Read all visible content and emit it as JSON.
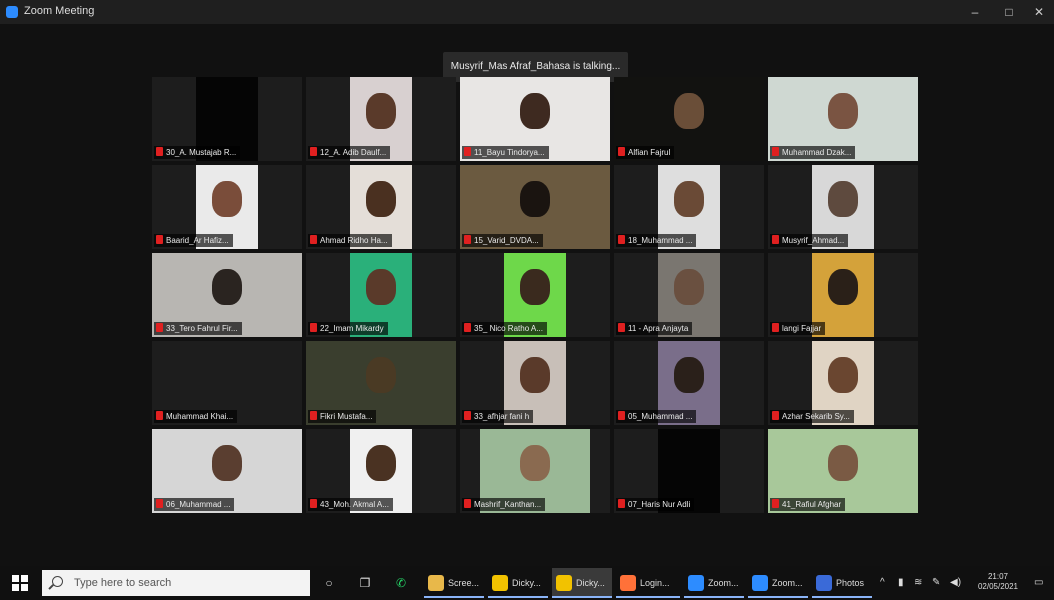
{
  "window": {
    "title": "Zoom Meeting",
    "controls": [
      "–",
      "□",
      "✕"
    ]
  },
  "speaking_banner": "Musyrif_Mas Afraf_Bahasa is talking...",
  "colors": {
    "muted_mic": "#e02020",
    "zoom_blue": "#2d8cff"
  },
  "participants": [
    {
      "name": "30_A. Mustajab R..."
    },
    {
      "name": "12_A. Adib Daulf..."
    },
    {
      "name": "11_Bayu Tindorya..."
    },
    {
      "name": "Alfian Fajrul"
    },
    {
      "name": "Muhammad Dzak..."
    },
    {
      "name": "Baarid_Ar Hafiz..."
    },
    {
      "name": "Ahmad Ridho Ha..."
    },
    {
      "name": "15_Varid_DVDA..."
    },
    {
      "name": "18_Muhammad ..."
    },
    {
      "name": "Musyrif_Ahmad..."
    },
    {
      "name": "33_Tero Fahrul Fir..."
    },
    {
      "name": "22_Imam Mikardy"
    },
    {
      "name": "35_ Nico Ratho A..."
    },
    {
      "name": "11 - Apra Anjayta"
    },
    {
      "name": "langi Fajjar"
    },
    {
      "name": "Muhammad Khai..."
    },
    {
      "name": "Fikri Mustafa..."
    },
    {
      "name": "33_afhjar fani h"
    },
    {
      "name": "05_Muhammad ..."
    },
    {
      "name": "Azhar Sekarib Sy..."
    },
    {
      "name": "06_Muhammad ..."
    },
    {
      "name": "43_Moh. Akmal A..."
    },
    {
      "name": "Mashrif_Kanthan..."
    },
    {
      "name": "07_Haris Nur Adli"
    },
    {
      "name": "41_Rafiul Afghar"
    }
  ],
  "taskbar": {
    "search_placeholder": "Type here to search",
    "apps": [
      {
        "label": "Scree...",
        "icon": "folder-icon"
      },
      {
        "label": "Dicky...",
        "icon": "sticky-notes-icon"
      },
      {
        "label": "Dicky...",
        "icon": "sticky-notes-icon"
      },
      {
        "label": "Login...",
        "icon": "firefox-icon"
      },
      {
        "label": "Zoom...",
        "icon": "zoom-icon"
      },
      {
        "label": "Zoom...",
        "icon": "zoom-icon"
      },
      {
        "label": "Photos",
        "icon": "photos-icon"
      }
    ],
    "time": "21:07",
    "date": "02/05/2021"
  }
}
